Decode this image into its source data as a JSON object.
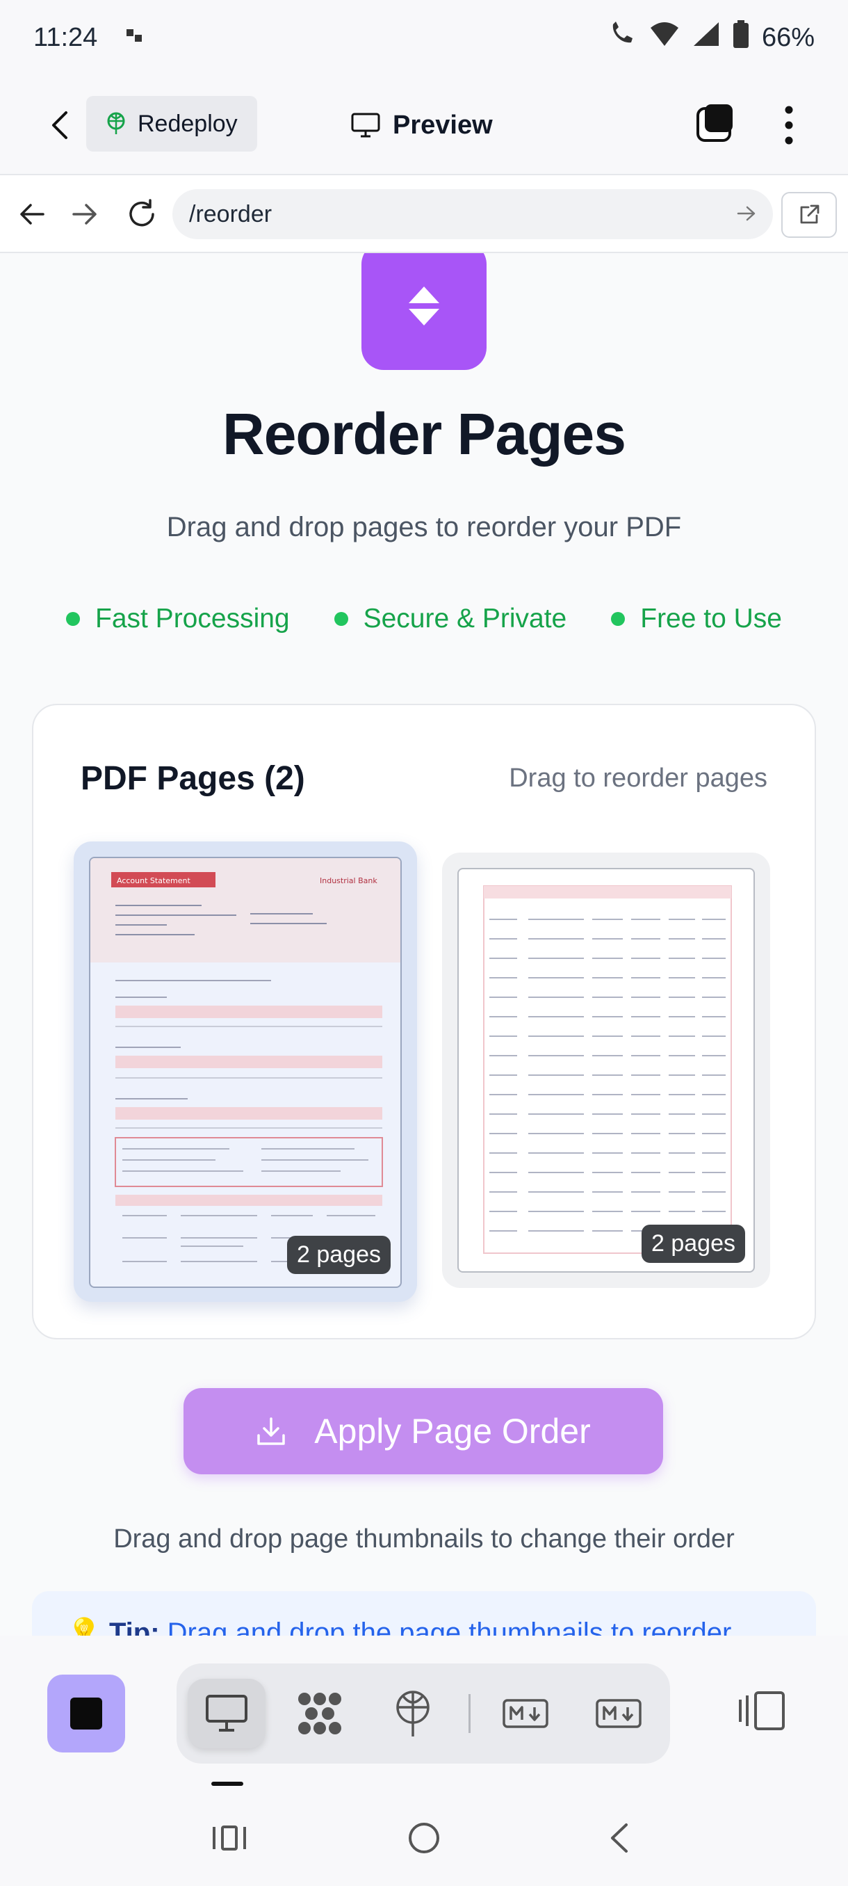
{
  "status_bar": {
    "time": "11:24",
    "battery": "66%"
  },
  "app_bar": {
    "redeploy_label": "Redeploy",
    "preview_label": "Preview"
  },
  "url_bar": {
    "path": "/reorder"
  },
  "hero": {
    "title": "Reorder Pages",
    "subtitle": "Drag and drop pages to reorder your PDF",
    "features": [
      "Fast Processing",
      "Secure & Private",
      "Free to Use"
    ],
    "accent_color": "#a855f7",
    "feature_color": "#16a34a"
  },
  "pages_card": {
    "title": "PDF Pages (2)",
    "hint": "Drag to reorder pages",
    "thumbnails": [
      {
        "badge": "2 pages",
        "doc_header": "Account Statement",
        "bank_name": "Industrial Bank"
      },
      {
        "badge": "2 pages"
      }
    ]
  },
  "actions": {
    "apply_label": "Apply Page Order",
    "apply_note": "Drag and drop page thumbnails to change their order",
    "apply_color": "#c48ef0"
  },
  "tip": {
    "label": "Tip:",
    "text": "Drag and drop the page thumbnails to reorder"
  },
  "toolbar": {
    "tools": [
      "monitor-icon",
      "network-icon",
      "deploy-icon",
      "markdown-icon",
      "markdown-icon"
    ]
  }
}
